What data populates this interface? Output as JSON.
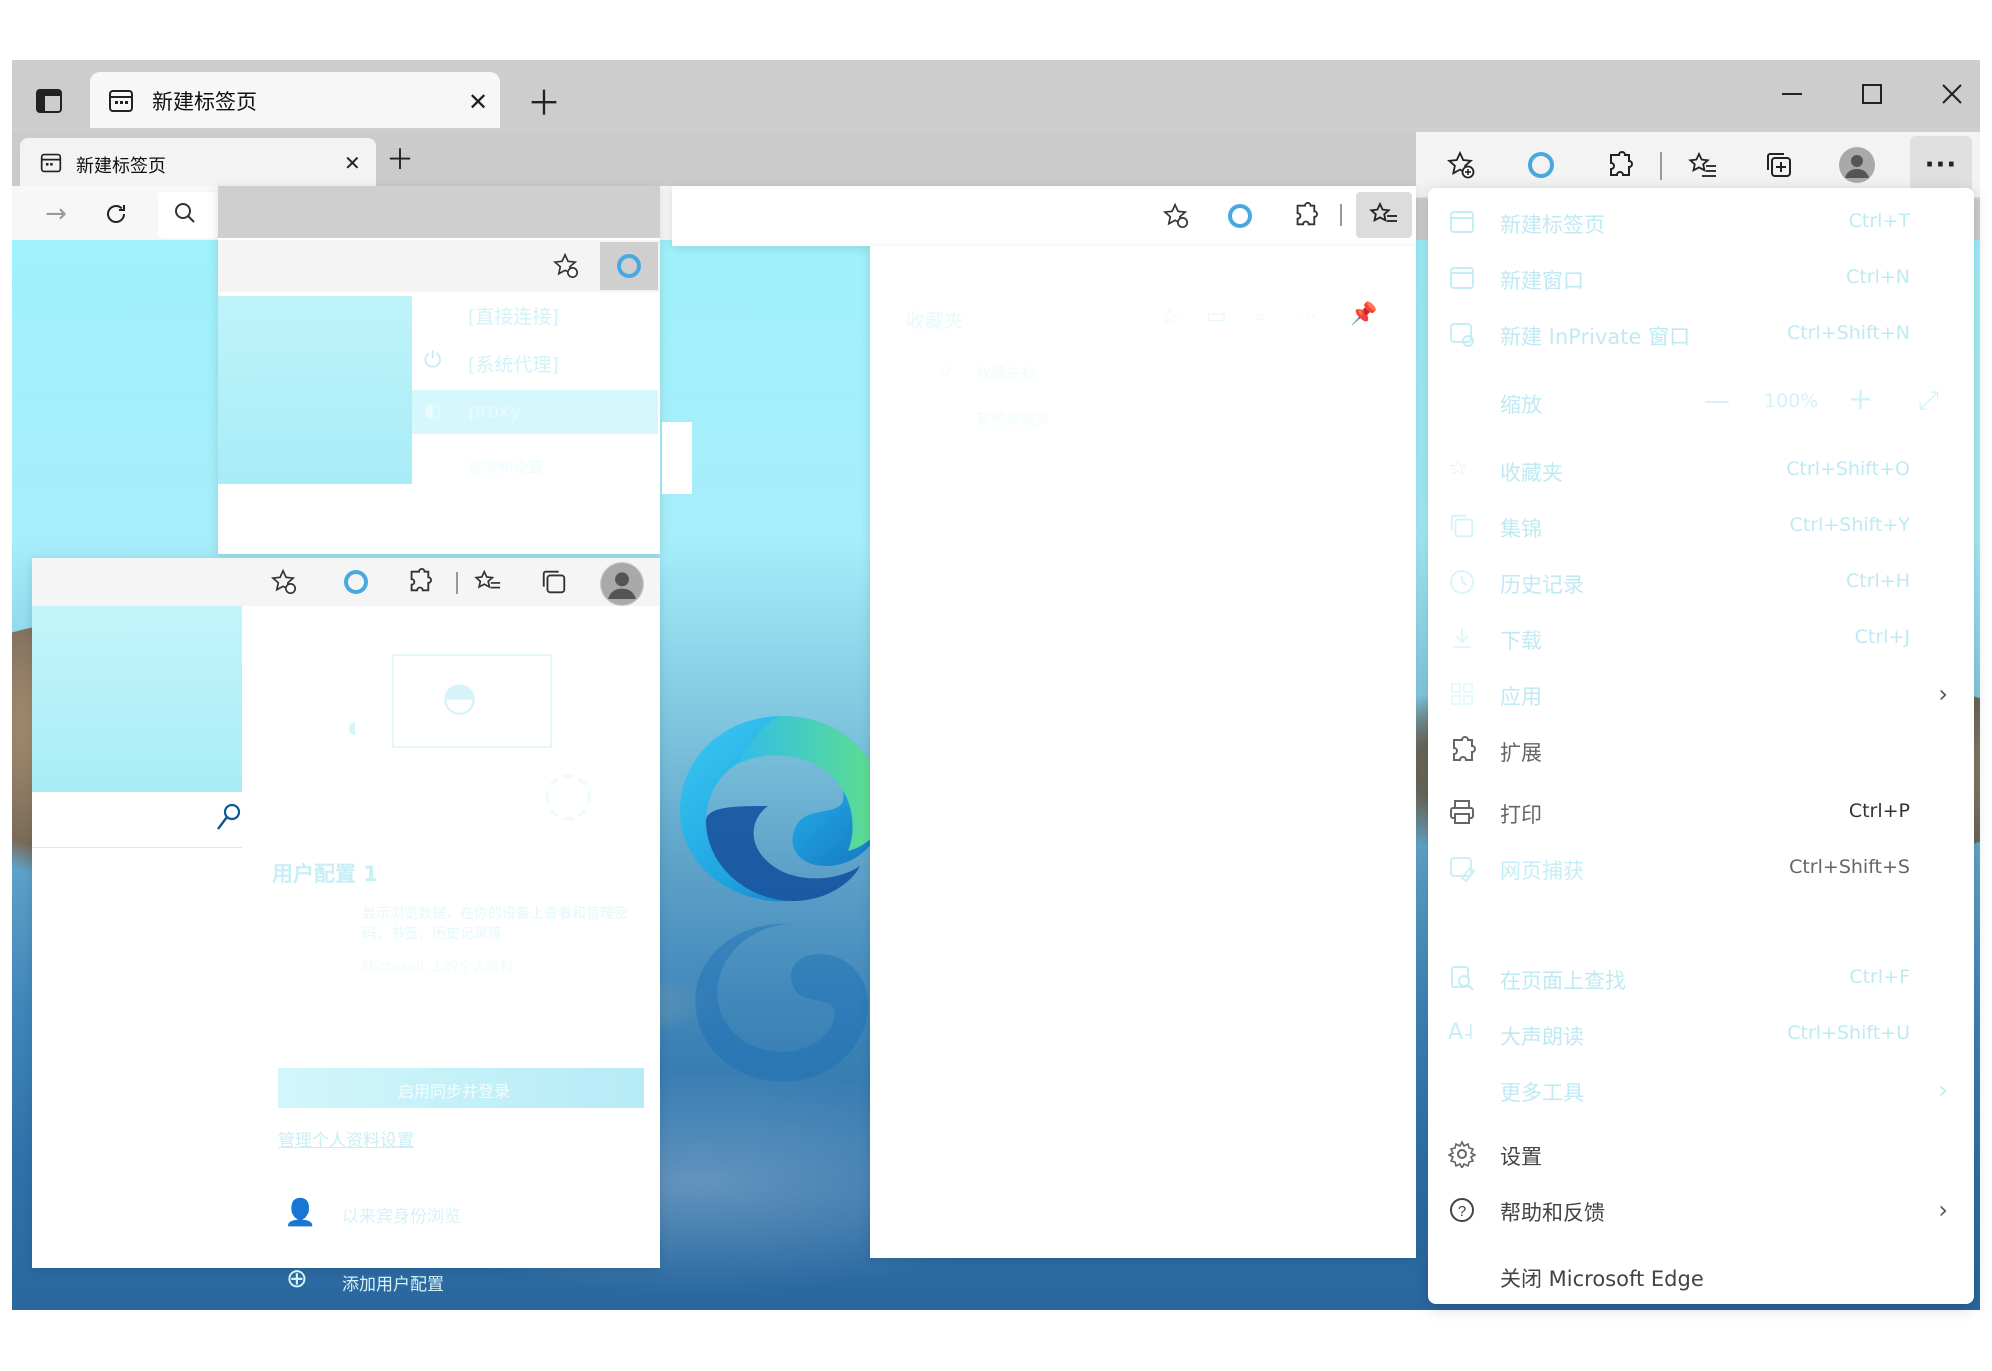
{
  "outer_tab": {
    "title": "新建标签页"
  },
  "inner_tab": {
    "title": "新建标签页"
  },
  "window_controls": {
    "minimize": "minimize-icon",
    "maximize": "maximize-icon",
    "close": "close-icon"
  },
  "toolbar_icons": [
    "add-favorite-icon",
    "cortana-icon",
    "extensions-icon",
    "favorites-icon",
    "collections-icon",
    "profile-icon",
    "more-icon"
  ],
  "favorites_panel": {
    "title": "收藏夹",
    "item1": "收藏夹栏",
    "item2": "其他收藏夹"
  },
  "proxy_panel": {
    "item1": "[直接连接]",
    "item2": "[系统代理]",
    "item3": "proxy",
    "item4": "选项和设置"
  },
  "profile_panel": {
    "name": "用户配置 1",
    "desc": "显示浏览数据，在你的设备上查看和管理密码、书签、历史记录等",
    "manage_profile": "Microsoft 上的个人资料",
    "sync_button": "启用同步并登录",
    "manage_settings": "管理个人资料设置",
    "guest": "以来宾身份浏览",
    "add_profile": "添加用户配置"
  },
  "menu": {
    "items": [
      {
        "label": "新建标签页",
        "shortcut": "Ctrl+T"
      },
      {
        "label": "新建窗口",
        "shortcut": "Ctrl+N"
      },
      {
        "label": "新建 InPrivate 窗口",
        "shortcut": "Ctrl+Shift+N"
      },
      {
        "label": "缩放",
        "zoom_value": "100%"
      },
      {
        "label": "收藏夹",
        "shortcut": "Ctrl+Shift+O"
      },
      {
        "label": "集锦",
        "shortcut": "Ctrl+Shift+Y"
      },
      {
        "label": "历史记录",
        "shortcut": "Ctrl+H"
      },
      {
        "label": "下载",
        "shortcut": "Ctrl+J"
      },
      {
        "label": "应用"
      },
      {
        "label": "扩展"
      },
      {
        "label": "打印",
        "shortcut": "Ctrl+P"
      },
      {
        "label": "网页捕获",
        "shortcut": "Ctrl+Shift+S"
      },
      {
        "label": "在页面上查找",
        "shortcut": "Ctrl+F"
      },
      {
        "label": "大声朗读",
        "shortcut": "Ctrl+Shift+U"
      },
      {
        "label": "更多工具"
      },
      {
        "label": "设置"
      },
      {
        "label": "帮助和反馈"
      },
      {
        "label": "关闭 Microsoft Edge"
      }
    ]
  },
  "colors": {
    "accent": "#0078d4",
    "faded_text": "#bfeaf3",
    "menu_bg": "#ffffff",
    "tabstrip": "#cdcdcd"
  }
}
